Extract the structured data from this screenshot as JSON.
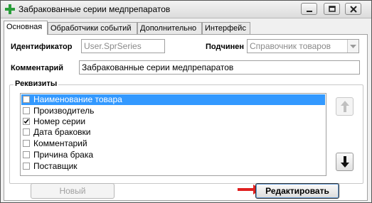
{
  "window": {
    "title": "Забракованные серии медпрепаратов",
    "icon": "green-cross-icon",
    "controls": [
      "minimize-icon",
      "maximize-icon",
      "close-icon"
    ]
  },
  "tabs": [
    {
      "label": "Основная",
      "active": true
    },
    {
      "label": "Обработчики событий",
      "active": false
    },
    {
      "label": "Дополнительно",
      "active": false
    },
    {
      "label": "Интерфейс",
      "active": false
    }
  ],
  "form": {
    "identifier_label": "Идентификатор",
    "identifier_value": "User.SprSeries",
    "subordinate_label": "Подчинен",
    "subordinate_value": "Справочник товаров",
    "comment_label": "Комментарий",
    "comment_value": "Забракованные серии медпрепаратов"
  },
  "attributes": {
    "group_title": "Реквизиты",
    "items": [
      {
        "label": "Наименование товара",
        "checked": false,
        "selected": true
      },
      {
        "label": "Производитель",
        "checked": false,
        "selected": false
      },
      {
        "label": "Номер серии",
        "checked": true,
        "selected": false
      },
      {
        "label": "Дата браковки",
        "checked": false,
        "selected": false
      },
      {
        "label": "Комментарий",
        "checked": false,
        "selected": false
      },
      {
        "label": "Причина брака",
        "checked": false,
        "selected": false
      },
      {
        "label": "Поставщик",
        "checked": false,
        "selected": false
      }
    ],
    "move_up_icon": "arrow-up-icon",
    "move_down_icon": "arrow-down-icon"
  },
  "buttons": {
    "new_label": "Новый",
    "edit_label": "Редактировать"
  },
  "colors": {
    "selection": "#3399ff",
    "pointer_arrow": "#e02020",
    "app_icon": "#2a9d3a"
  }
}
